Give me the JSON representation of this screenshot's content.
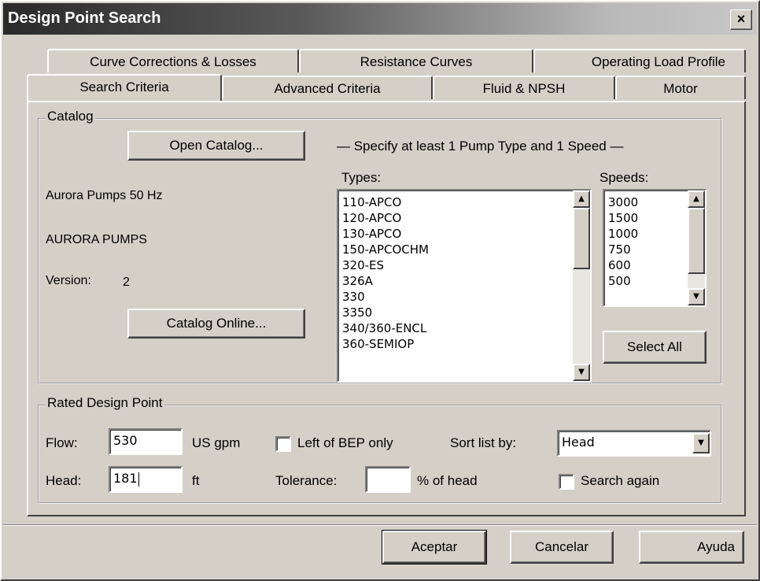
{
  "window": {
    "title": "Design Point Search",
    "close_glyph": "×"
  },
  "tabs_row1": [
    "Curve Corrections & Losses",
    "Resistance Curves",
    "Operating Load Profile"
  ],
  "tabs_row2": [
    "Search Criteria",
    "Advanced Criteria",
    "Fluid & NPSH",
    "Motor"
  ],
  "catalog": {
    "legend": "Catalog",
    "open_button": "Open Catalog...",
    "online_button": "Catalog Online...",
    "name": "Aurora Pumps 50 Hz",
    "publisher": "AURORA PUMPS",
    "version_label": "Version:",
    "version_value": "2",
    "instruction": "— Specify at least 1 Pump Type and 1 Speed —",
    "types_label": "Types:",
    "speeds_label": "Speeds:",
    "types": [
      "110-APCO",
      "120-APCO",
      "130-APCO",
      "150-APCOCHM",
      "320-ES",
      "326A",
      "330",
      "3350",
      "340/360-ENCL",
      "360-SEMIOP"
    ],
    "speeds": [
      "3000",
      "1500",
      "1000",
      " 750",
      " 600",
      " 500"
    ],
    "select_all_button": "Select All"
  },
  "design_point": {
    "legend": "Rated Design Point",
    "flow_label": "Flow:",
    "flow_value": "530",
    "flow_unit": "US gpm",
    "head_label": "Head:",
    "head_value": "181",
    "head_unit": "ft",
    "left_bep_label": "Left of BEP only",
    "tolerance_label": "Tolerance:",
    "tolerance_value": "",
    "tolerance_unit": "% of head",
    "sort_label": "Sort list by:",
    "sort_value": "Head",
    "search_again_label": "Search again"
  },
  "footer": {
    "ok": "Aceptar",
    "cancel": "Cancelar",
    "help": "Ayuda"
  }
}
